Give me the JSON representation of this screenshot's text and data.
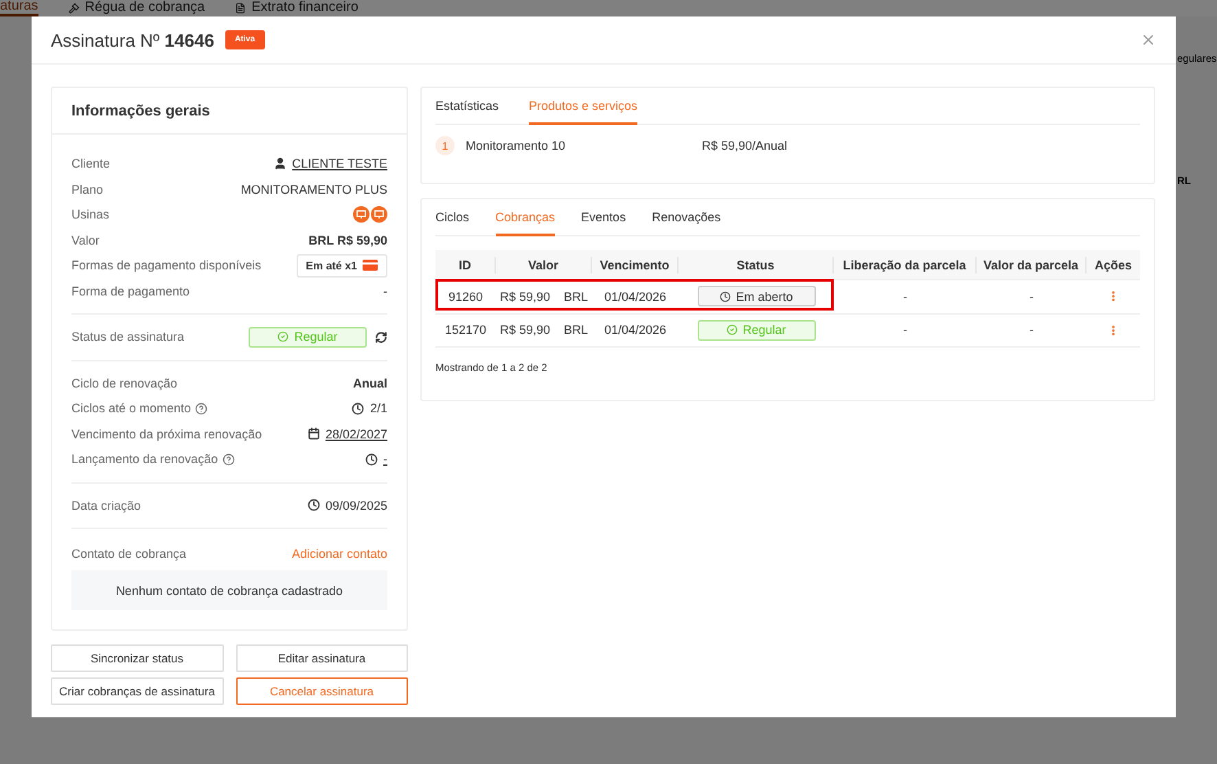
{
  "background": {
    "nav_tabs": [
      {
        "label": "aturas",
        "selected": true
      },
      {
        "label": "Régua de cobrança",
        "selected": false
      },
      {
        "label": "Extrato financeiro",
        "selected": false
      }
    ],
    "side_texts": [
      "egulares",
      "RL"
    ]
  },
  "modal": {
    "title": "Assinatura Nº **14646**",
    "status_badge": "Ativa"
  },
  "general_info": {
    "title": "Informações gerais",
    "sections": [
      {
        "rows": [
          {
            "label": "Cliente",
            "kind": "user_link",
            "value": "CLIENTE TESTE"
          },
          {
            "label": "Plano",
            "kind": "text",
            "value": "MONITORAMENTO PLUS"
          },
          {
            "label": "Usinas",
            "kind": "plants"
          },
          {
            "label": "Valor",
            "kind": "bold",
            "value": "BRL R$ 59,90"
          },
          {
            "label": "Formas de pagamento disponíveis",
            "kind": "chip",
            "value": "Em até x1"
          },
          {
            "label": "Forma de pagamento",
            "kind": "text",
            "value": "-"
          }
        ]
      },
      {
        "rows": [
          {
            "label": "Status de assinatura",
            "kind": "status",
            "value": "Regular"
          }
        ]
      },
      {
        "rows": [
          {
            "label": "Ciclo de renovação",
            "kind": "bold",
            "value": "Anual"
          },
          {
            "label": "Ciclos até o momento",
            "kind": "clock",
            "value": "2/1",
            "help": true
          },
          {
            "label": "Vencimento da próxima renovação",
            "kind": "calendar_link",
            "value": "28/02/2027"
          },
          {
            "label": "Lançamento da renovação",
            "kind": "clock_link",
            "value": "-",
            "help": true
          }
        ]
      },
      {
        "rows": [
          {
            "label": "Data criação",
            "kind": "clock",
            "value": "09/09/2025"
          }
        ]
      }
    ],
    "contact": {
      "label": "Contato de cobrança",
      "action": "Adicionar contato",
      "empty": "Nenhum contato de cobrança cadastrado"
    }
  },
  "buttons": [
    {
      "label": "Sincronizar status",
      "kind": "default"
    },
    {
      "label": "Editar assinatura",
      "kind": "default"
    },
    {
      "label": "Criar cobranças de assinatura",
      "kind": "default"
    },
    {
      "label": "Cancelar assinatura",
      "kind": "danger"
    }
  ],
  "products": {
    "tabs": [
      {
        "label": "Estatísticas",
        "selected": false
      },
      {
        "label": "Produtos e serviços",
        "selected": true
      }
    ],
    "items": [
      {
        "index": "1",
        "name": "Monitoramento 10",
        "price": "R$ 59,90/Anual"
      }
    ]
  },
  "charges": {
    "tabs": [
      {
        "label": "Ciclos",
        "selected": false
      },
      {
        "label": "Cobranças",
        "selected": true
      },
      {
        "label": "Eventos",
        "selected": false
      },
      {
        "label": "Renovações",
        "selected": false
      }
    ],
    "columns": [
      "ID",
      "Valor",
      "Vencimento",
      "Status",
      "Liberação da parcela",
      "Valor da parcela",
      "Ações"
    ],
    "rows": [
      {
        "id": "91260",
        "amount": "R$ 59,90",
        "currency": "BRL",
        "due": "01/04/2026",
        "status": {
          "label": "Em aberto",
          "kind": "open"
        },
        "release": "-",
        "installment": "-",
        "highlighted": true
      },
      {
        "id": "152170",
        "amount": "R$ 59,90",
        "currency": "BRL",
        "due": "01/04/2026",
        "status": {
          "label": "Regular",
          "kind": "regular"
        },
        "release": "-",
        "installment": "-",
        "highlighted": false
      }
    ],
    "footer": "Mostrando de 1 a 2 de 2"
  }
}
